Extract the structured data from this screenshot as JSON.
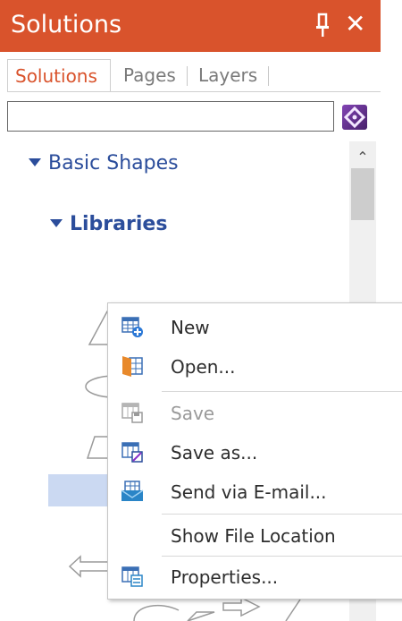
{
  "panel": {
    "title": "Solutions",
    "accent": "#d9532c",
    "tabs": [
      "Solutions",
      "Pages",
      "Layers"
    ],
    "active_tab": "Solutions",
    "search": {
      "value": "",
      "placeholder": ""
    }
  },
  "tree": {
    "root_label": "Basic Shapes",
    "child_label": "Libraries"
  },
  "context_menu": {
    "items": [
      {
        "label": "New",
        "icon": "new-icon",
        "enabled": true
      },
      {
        "label": "Open...",
        "icon": "open-icon",
        "enabled": true
      },
      {
        "label": "Save",
        "icon": "save-icon",
        "enabled": false
      },
      {
        "label": "Save as...",
        "icon": "save-as-icon",
        "enabled": true
      },
      {
        "label": "Send via E-mail...",
        "icon": "email-icon",
        "enabled": true
      },
      {
        "label": "Show File Location",
        "icon": "",
        "enabled": true
      },
      {
        "label": "Properties...",
        "icon": "properties-icon",
        "enabled": true
      }
    ]
  }
}
